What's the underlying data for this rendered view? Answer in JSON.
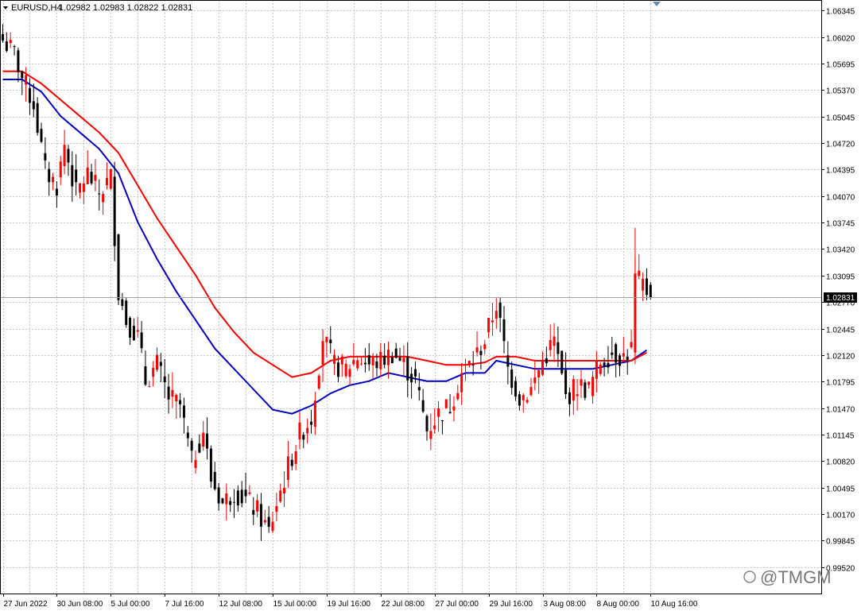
{
  "header": {
    "symbol": "EURUSD,H4",
    "ohlc": "1.02982 1.02983 1.02822 1.02831"
  },
  "watermark": "@TMGM",
  "price_tag": "1.02831",
  "colors": {
    "bull": "#ff0000",
    "bear": "#000000",
    "ma_fast": "#0000c8",
    "ma_slow": "#ff0000",
    "grid": "#c8c8c8",
    "price_line": "#a0a0a0"
  },
  "chart_data": {
    "type": "candlestick",
    "symbol": "EURUSD",
    "timeframe": "H4",
    "grid": true,
    "ylim": [
      0.99195,
      1.06475
    ],
    "y_ticks": [
      "1.06345",
      "1.06020",
      "1.05695",
      "1.05370",
      "1.05045",
      "1.04720",
      "1.04395",
      "1.04070",
      "1.03745",
      "1.03420",
      "1.03095",
      "1.02770",
      "1.02445",
      "1.02120",
      "1.01795",
      "1.01470",
      "1.01145",
      "1.00820",
      "1.00495",
      "1.00170",
      "0.99845",
      "0.99520"
    ],
    "x_ticks": [
      {
        "bar": 0,
        "label": "27 Jun 2022"
      },
      {
        "bar": 14,
        "label": "30 Jun 08:00"
      },
      {
        "bar": 28,
        "label": "5 Jul 00:00"
      },
      {
        "bar": 42,
        "label": "7 Jul 16:00"
      },
      {
        "bar": 56,
        "label": "12 Jul 08:00"
      },
      {
        "bar": 70,
        "label": "15 Jul 00:00"
      },
      {
        "bar": 84,
        "label": "19 Jul 16:00"
      },
      {
        "bar": 98,
        "label": "22 Jul 08:00"
      },
      {
        "bar": 112,
        "label": "27 Jul 00:00"
      },
      {
        "bar": 126,
        "label": "29 Jul 16:00"
      },
      {
        "bar": 140,
        "label": "3 Aug 08:00"
      },
      {
        "bar": 154,
        "label": "8 Aug 00:00"
      },
      {
        "bar": 168,
        "label": "10 Aug 16:00"
      }
    ],
    "last_price": 1.02831,
    "close_anchors": [
      [
        0,
        1.0598
      ],
      [
        3,
        1.0582
      ],
      [
        5,
        1.0552
      ],
      [
        8,
        1.052
      ],
      [
        11,
        1.0438
      ],
      [
        14,
        1.042
      ],
      [
        16,
        1.047
      ],
      [
        19,
        1.041
      ],
      [
        22,
        1.0435
      ],
      [
        25,
        1.041
      ],
      [
        28,
        1.043
      ],
      [
        30,
        1.029
      ],
      [
        32,
        1.0255
      ],
      [
        35,
        1.0235
      ],
      [
        37,
        1.018
      ],
      [
        40,
        1.02
      ],
      [
        43,
        1.016
      ],
      [
        46,
        1.015
      ],
      [
        49,
        1.008
      ],
      [
        52,
        1.012
      ],
      [
        54,
        1.006
      ],
      [
        57,
        1.003
      ],
      [
        60,
        1.0045
      ],
      [
        63,
        1.0035
      ],
      [
        66,
        1.002
      ],
      [
        69,
        0.9995
      ],
      [
        71,
        1.003
      ],
      [
        74,
        1.0075
      ],
      [
        77,
        1.0115
      ],
      [
        80,
        1.0135
      ],
      [
        83,
        1.0235
      ],
      [
        86,
        1.02
      ],
      [
        89,
        1.0195
      ],
      [
        92,
        1.021
      ],
      [
        95,
        1.02
      ],
      [
        98,
        1.0205
      ],
      [
        101,
        1.0215
      ],
      [
        104,
        1.02
      ],
      [
        107,
        1.018
      ],
      [
        110,
        1.012
      ],
      [
        113,
        1.014
      ],
      [
        116,
        1.015
      ],
      [
        119,
        1.019
      ],
      [
        122,
        1.0205
      ],
      [
        125,
        1.023
      ],
      [
        128,
        1.0275
      ],
      [
        131,
        1.0195
      ],
      [
        134,
        1.016
      ],
      [
        137,
        1.017
      ],
      [
        140,
        1.0205
      ],
      [
        143,
        1.023
      ],
      [
        146,
        1.016
      ],
      [
        149,
        1.0175
      ],
      [
        152,
        1.017
      ],
      [
        155,
        1.0205
      ],
      [
        158,
        1.0215
      ],
      [
        161,
        1.021
      ],
      [
        163,
        1.022
      ],
      [
        164,
        1.0305
      ],
      [
        166,
        1.0298
      ],
      [
        168,
        1.0283
      ]
    ],
    "series": [
      {
        "type": "moving_average",
        "points": [
          [
            0,
            1.055
          ],
          [
            5,
            1.055
          ],
          [
            10,
            1.0535
          ],
          [
            15,
            1.0505
          ],
          [
            20,
            1.0485
          ],
          [
            25,
            1.0465
          ],
          [
            30,
            1.0435
          ],
          [
            35,
            1.0375
          ],
          [
            40,
            1.033
          ],
          [
            45,
            1.029
          ],
          [
            50,
            1.0255
          ],
          [
            55,
            1.022
          ],
          [
            60,
            1.0195
          ],
          [
            65,
            1.017
          ],
          [
            70,
            1.0145
          ],
          [
            75,
            1.014
          ],
          [
            80,
            1.015
          ],
          [
            85,
            1.0165
          ],
          [
            90,
            1.0175
          ],
          [
            95,
            1.018
          ],
          [
            100,
            1.019
          ],
          [
            105,
            1.0185
          ],
          [
            110,
            1.018
          ],
          [
            115,
            1.018
          ],
          [
            120,
            1.019
          ],
          [
            125,
            1.019
          ],
          [
            128,
            1.0205
          ],
          [
            133,
            1.02
          ],
          [
            138,
            1.0195
          ],
          [
            143,
            1.0195
          ],
          [
            148,
            1.0195
          ],
          [
            153,
            1.0195
          ],
          [
            158,
            1.02
          ],
          [
            163,
            1.0205
          ],
          [
            167,
            1.0218
          ]
        ]
      },
      {
        "type": "moving_average",
        "points": [
          [
            0,
            1.056
          ],
          [
            5,
            1.056
          ],
          [
            10,
            1.0545
          ],
          [
            15,
            1.0525
          ],
          [
            20,
            1.0505
          ],
          [
            25,
            1.0485
          ],
          [
            30,
            1.046
          ],
          [
            35,
            1.042
          ],
          [
            40,
            1.038
          ],
          [
            45,
            1.0345
          ],
          [
            50,
            1.031
          ],
          [
            55,
            1.027
          ],
          [
            60,
            1.024
          ],
          [
            65,
            1.0215
          ],
          [
            70,
            1.02
          ],
          [
            75,
            1.0185
          ],
          [
            80,
            1.019
          ],
          [
            85,
            1.0205
          ],
          [
            90,
            1.021
          ],
          [
            95,
            1.021
          ],
          [
            100,
            1.021
          ],
          [
            105,
            1.021
          ],
          [
            110,
            1.0205
          ],
          [
            115,
            1.02
          ],
          [
            120,
            1.02
          ],
          [
            125,
            1.0203
          ],
          [
            128,
            1.021
          ],
          [
            133,
            1.021
          ],
          [
            138,
            1.0205
          ],
          [
            143,
            1.0205
          ],
          [
            148,
            1.0205
          ],
          [
            153,
            1.0205
          ],
          [
            158,
            1.0205
          ],
          [
            163,
            1.0205
          ],
          [
            167,
            1.0215
          ]
        ]
      }
    ]
  }
}
